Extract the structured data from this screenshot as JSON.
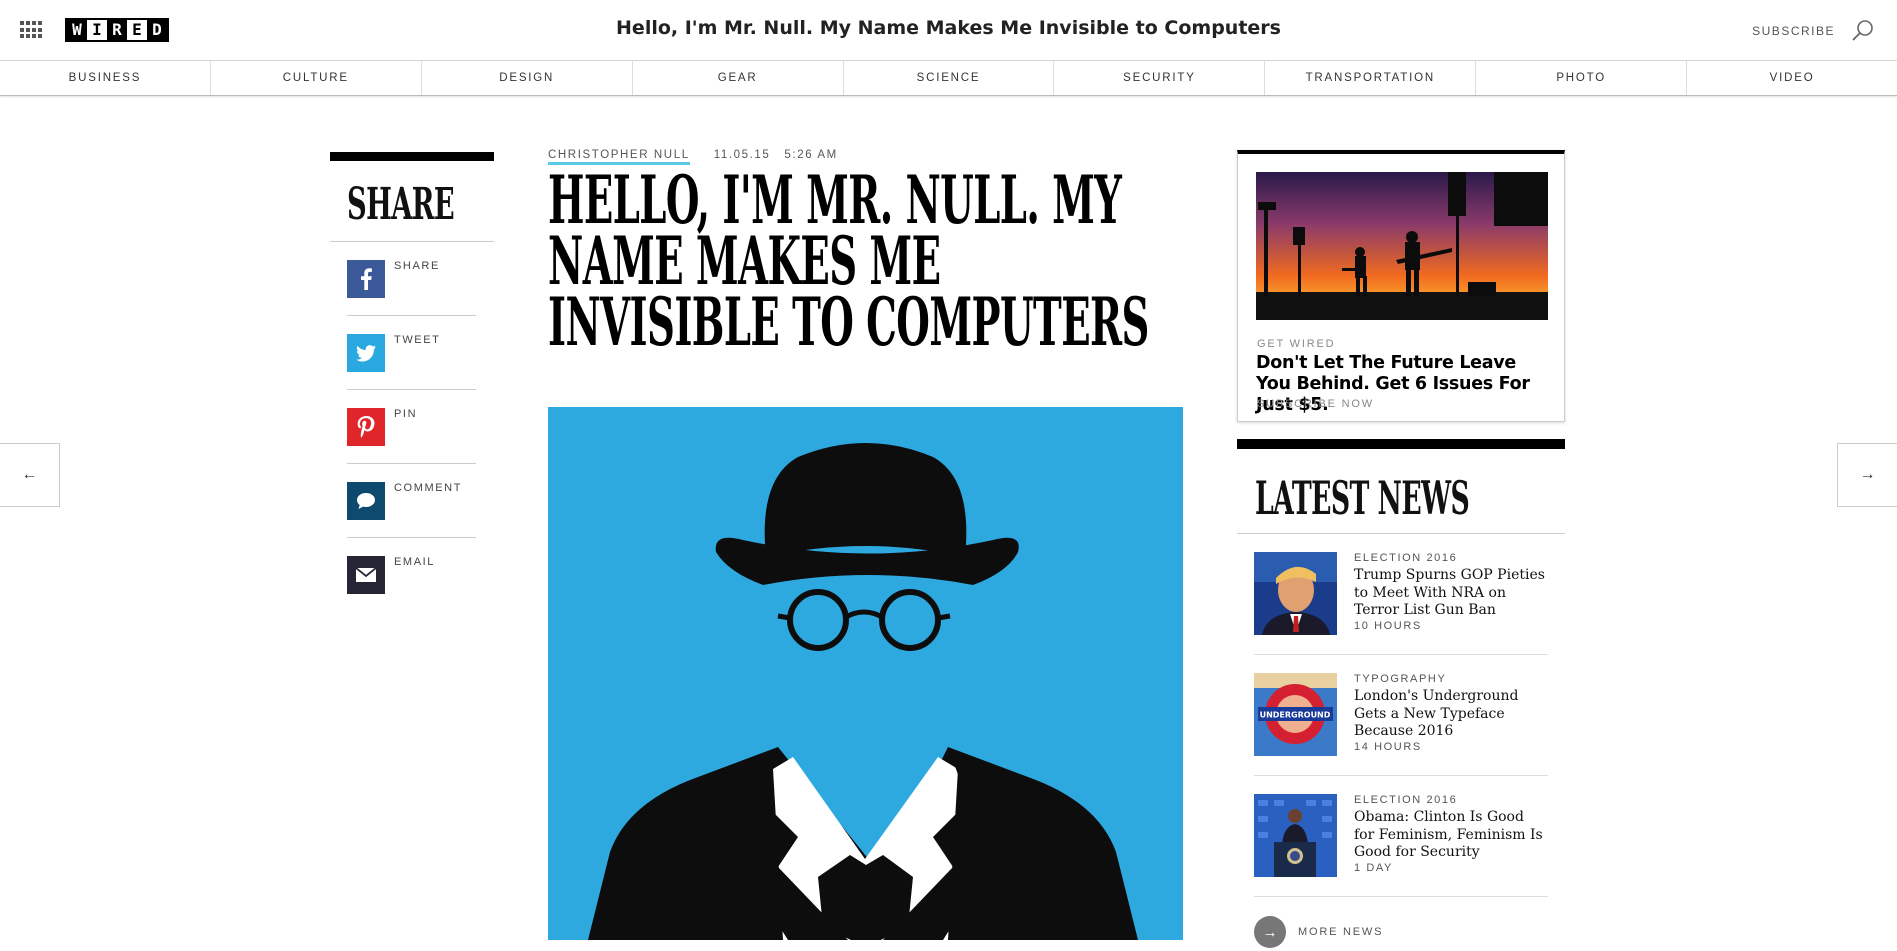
{
  "topbar": {
    "logo_letters": [
      "W",
      "I",
      "R",
      "E",
      "D"
    ],
    "title": "Hello, I'm Mr. Null. My Name Makes Me Invisible to Computers",
    "subscribe_label": "SUBSCRIBE"
  },
  "nav": {
    "items": [
      "BUSINESS",
      "CULTURE",
      "DESIGN",
      "GEAR",
      "SCIENCE",
      "SECURITY",
      "TRANSPORTATION",
      "PHOTO",
      "VIDEO"
    ]
  },
  "arrows": {
    "prev": "←",
    "next": "→"
  },
  "share": {
    "title": "SHARE",
    "items": [
      {
        "label": "SHARE",
        "icon": "facebook-icon",
        "color": "#3b5998"
      },
      {
        "label": "TWEET",
        "icon": "twitter-icon",
        "color": "#2aa9e0"
      },
      {
        "label": "PIN",
        "icon": "pinterest-icon",
        "color": "#e0262b"
      },
      {
        "label": "COMMENT",
        "icon": "comment-icon",
        "color": "#0e4a6e"
      },
      {
        "label": "EMAIL",
        "icon": "email-icon",
        "color": "#252533"
      }
    ]
  },
  "article": {
    "author": "CHRISTOPHER NULL",
    "date": "11.05.15",
    "time": "5:26 AM",
    "headline": "Hello, I'm Mr. Null. My Name Makes Me Invisible to Computers",
    "hero_color": "#2ea9e0"
  },
  "ad": {
    "kicker": "GET WIRED",
    "headline": "Don't Let The Future Leave You Behind. Get 6 Issues For Just $5.",
    "cta": "SUBSCRIBE NOW"
  },
  "latest": {
    "title": "LATEST NEWS",
    "items": [
      {
        "kicker": "ELECTION 2016",
        "headline": "Trump Spurns GOP Pieties to Meet With NRA on Terror List Gun Ban",
        "time": "10 HOURS"
      },
      {
        "kicker": "TYPOGRAPHY",
        "headline": "London's Underground Gets a New Typeface Because 2016",
        "time": "14 HOURS",
        "thumb_text": "UNDERGROUND"
      },
      {
        "kicker": "ELECTION 2016",
        "headline": "Obama: Clinton Is Good for Feminism, Feminism Is Good for Security",
        "time": "1 DAY"
      }
    ],
    "more_label": "MORE NEWS",
    "more_icon": "→"
  }
}
